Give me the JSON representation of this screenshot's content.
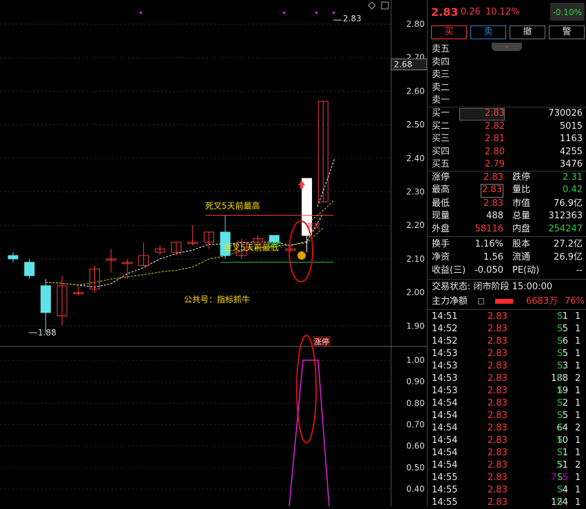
{
  "chart": {
    "price_axis": [
      "2.80",
      "2.70",
      "2.60",
      "2.50",
      "2.40",
      "2.30",
      "2.20",
      "2.10",
      "2.00",
      "1.90"
    ],
    "current_marker": "2.68",
    "high_label": "2.83",
    "low_label": "1.88",
    "ann_dead_cross": "死叉5天前最高",
    "ann_gold_cross": "金叉5天前最低",
    "ann_public": "公共号：指标抓牛",
    "ann_small_1": "死叉",
    "ann_small_2": "金叉",
    "limit_badge": "涨停",
    "indicator_axis": [
      "1.00",
      "0.90",
      "0.80",
      "0.70",
      "0.60",
      "0.50",
      "0.40"
    ]
  },
  "quote": {
    "price": "2.83",
    "change": "0.26",
    "change_pct": "10.12%",
    "side_box": "-0.10%",
    "btn_buy": "买",
    "btn_sell": "卖",
    "btn_cancel": "撤",
    "btn_warn": "警",
    "tab_arrow": "⌄"
  },
  "ask": [
    "卖五",
    "卖四",
    "卖三",
    "卖二",
    "卖一"
  ],
  "bid": [
    {
      "label": "买一",
      "price": "2.83",
      "vol": "730026"
    },
    {
      "label": "买二",
      "price": "2.82",
      "vol": "5015"
    },
    {
      "label": "买三",
      "price": "2.81",
      "vol": "1163"
    },
    {
      "label": "买四",
      "price": "2.80",
      "vol": "4255"
    },
    {
      "label": "买五",
      "price": "2.79",
      "vol": "3476"
    }
  ],
  "stats": {
    "zt_l": "涨停",
    "zt_v": "2.83",
    "dt_l": "跌停",
    "dt_v": "2.31",
    "zg_l": "最高",
    "zg_v": "2.83",
    "lb_l": "量比",
    "lb_v": "0.42",
    "zd_l": "最低",
    "zd_v": "2.83",
    "sz_l": "市值",
    "sz_v": "76.9亿",
    "xl_l": "现量",
    "xl_v": "488",
    "zl_l": "总量",
    "zl_v": "312363",
    "wp_l": "外盘",
    "wp_v": "58116",
    "np_l": "内盘",
    "np_v": "254247",
    "hs_l": "换手",
    "hs_v": "1.16%",
    "gb_l": "股本",
    "gb_v": "27.2亿",
    "jz_l": "净资",
    "jz_v": "1.56",
    "lt_l": "流通",
    "lt_v": "26.9亿",
    "sy_l": "收益(三)",
    "sy_v": "-0.050",
    "pe_l": "PE(动)",
    "pe_v": "--"
  },
  "status": {
    "trade_state": "交易状态: 闭市阶段 15:00:00",
    "main_flow_label": "主力净额",
    "main_flow_value": "6683万",
    "main_flow_pct": "76%"
  },
  "ticks": [
    {
      "t": "14:51",
      "p": "2.83",
      "v": "1",
      "d": "S",
      "n": "1"
    },
    {
      "t": "14:52",
      "p": "2.83",
      "v": "5",
      "d": "S",
      "n": "1"
    },
    {
      "t": "14:52",
      "p": "2.83",
      "v": "6",
      "d": "S",
      "n": "1"
    },
    {
      "t": "14:53",
      "p": "2.83",
      "v": "5",
      "d": "S",
      "n": "1"
    },
    {
      "t": "14:53",
      "p": "2.83",
      "v": "3",
      "d": "S",
      "n": "1"
    },
    {
      "t": "14:53",
      "p": "2.83",
      "v": "188",
      "d": "S",
      "n": "2"
    },
    {
      "t": "14:53",
      "p": "2.83",
      "v": "19",
      "d": "S",
      "n": "1"
    },
    {
      "t": "14:54",
      "p": "2.83",
      "v": "2",
      "d": "S",
      "n": "1"
    },
    {
      "t": "14:54",
      "p": "2.83",
      "v": "5",
      "d": "S",
      "n": "1"
    },
    {
      "t": "14:54",
      "p": "2.83",
      "v": "64",
      "d": "S",
      "n": "2"
    },
    {
      "t": "14:54",
      "p": "2.83",
      "v": "10",
      "d": "S",
      "n": "1"
    },
    {
      "t": "14:54",
      "p": "2.83",
      "v": "1",
      "d": "S",
      "n": "1"
    },
    {
      "t": "14:54",
      "p": "2.83",
      "v": "51",
      "d": "S",
      "n": "2"
    },
    {
      "t": "14:55",
      "p": "2.83",
      "v": "715",
      "d": "S",
      "n": "1"
    },
    {
      "t": "14:55",
      "p": "2.83",
      "v": "4",
      "d": "S",
      "n": "1"
    },
    {
      "t": "14:55",
      "p": "2.83",
      "v": "124",
      "d": "S",
      "n": "1"
    }
  ],
  "candles": [
    {
      "o": 2.11,
      "h": 2.12,
      "l": 2.09,
      "c": 2.1
    },
    {
      "o": 2.09,
      "h": 2.1,
      "l": 2.04,
      "c": 2.05
    },
    {
      "o": 2.02,
      "h": 2.04,
      "l": 1.88,
      "c": 1.94
    },
    {
      "o": 1.93,
      "h": 2.05,
      "l": 1.9,
      "c": 2.02
    },
    {
      "o": 2.0,
      "h": 2.02,
      "l": 1.99,
      "c": 2.0
    },
    {
      "o": 2.01,
      "h": 2.08,
      "l": 2.0,
      "c": 2.07
    },
    {
      "o": 2.1,
      "h": 2.13,
      "l": 2.06,
      "c": 2.1
    },
    {
      "o": 2.09,
      "h": 2.1,
      "l": 2.04,
      "c": 2.09
    },
    {
      "o": 2.08,
      "h": 2.15,
      "l": 2.08,
      "c": 2.11
    },
    {
      "o": 2.12,
      "h": 2.14,
      "l": 2.11,
      "c": 2.13
    },
    {
      "o": 2.12,
      "h": 2.15,
      "l": 2.11,
      "c": 2.15
    },
    {
      "o": 2.15,
      "h": 2.2,
      "l": 2.14,
      "c": 2.15
    },
    {
      "o": 2.15,
      "h": 2.18,
      "l": 2.13,
      "c": 2.18
    },
    {
      "o": 2.18,
      "h": 2.23,
      "l": 2.1,
      "c": 2.11
    },
    {
      "o": 2.11,
      "h": 2.16,
      "l": 2.1,
      "c": 2.15
    },
    {
      "o": 2.15,
      "h": 2.17,
      "l": 2.13,
      "c": 2.16
    },
    {
      "o": 2.17,
      "h": 2.17,
      "l": 2.14,
      "c": 2.15
    },
    {
      "o": 2.13,
      "h": 2.14,
      "l": 2.12,
      "c": 2.13
    },
    {
      "o": 2.34,
      "h": 2.34,
      "l": 2.12,
      "c": 2.17
    },
    {
      "o": 2.27,
      "h": 2.57,
      "l": 2.27,
      "c": 2.57
    }
  ],
  "colors": {
    "up": "#ff3b3b",
    "down": "#5ee3e8",
    "ma5": "#ffffff",
    "ma10": "#e8d000",
    "accent": "#ff3b3b",
    "indicator": "#e020e0"
  }
}
